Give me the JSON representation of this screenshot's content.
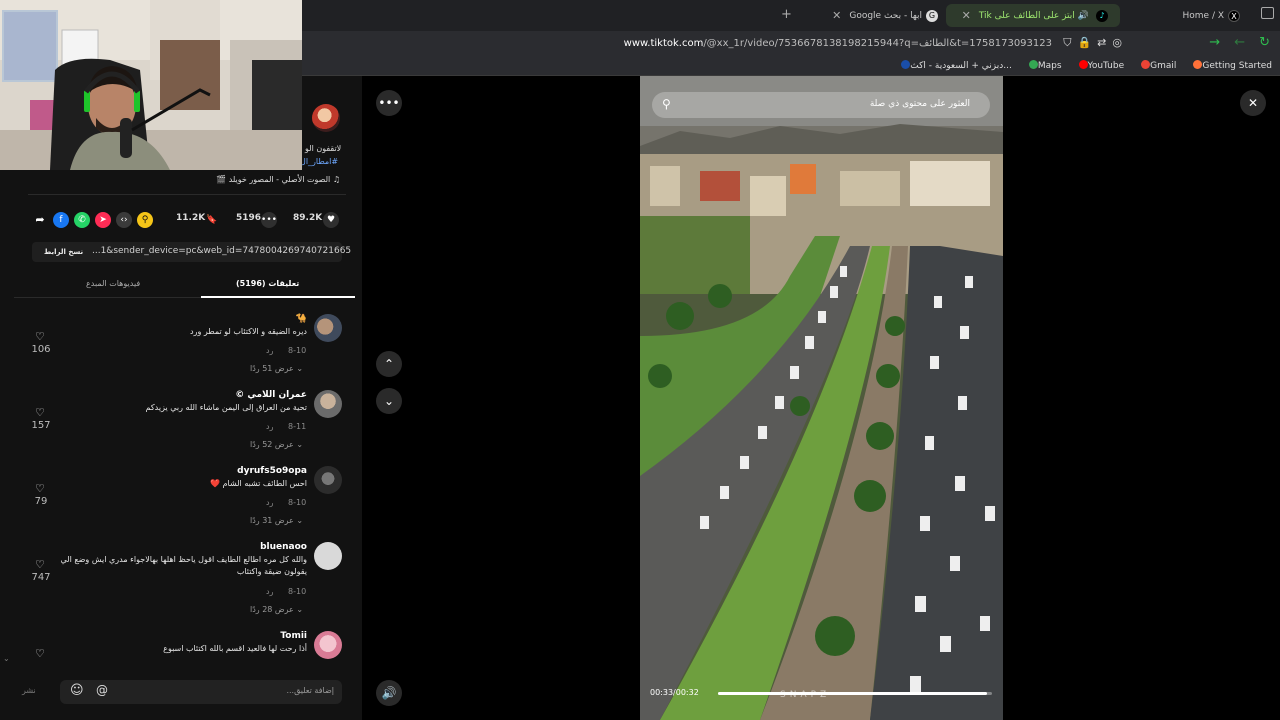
{
  "browser": {
    "tabs": [
      {
        "title": "Home / X",
        "icon": "x-logo-icon"
      },
      {
        "title": "ابتز على الطائف على Tik",
        "icon": "tiktok-icon",
        "active": true
      },
      {
        "title": "ابها - بحث Google",
        "icon": "google-icon"
      }
    ],
    "new_tab": "+",
    "url_host": "www.tiktok.com",
    "url_path": "/@xx_1r/video/7536678138198215944?q=الطائف&t=1758173093123",
    "bookmarks": [
      "Getting Started",
      "Gmail",
      "YouTube",
      "Maps",
      "دبزني + السعودية - اكث..."
    ]
  },
  "post": {
    "caption_line1": "لاتقفون الو",
    "caption_line2": "#امطار_ال",
    "sound": "الصوت الأصلي - المصور خويلد 🎬",
    "likes": "89.2K",
    "comments": "5196",
    "saves": "11.2K",
    "link": "...1&sender_device=pc&web_id=7478004269740721665",
    "copy_link": "نسخ الرابط"
  },
  "tabs": {
    "comments": "تعليقات (5196)",
    "creator_videos": "فيديوهات المبدع"
  },
  "comments": [
    {
      "user": "🐪",
      "text": "ديره الضيقه و الاكتئاب لو تمطر ورد",
      "date": "8-10",
      "reply": "رد",
      "view_replies": "عرض 51 ردًا",
      "likes": "106"
    },
    {
      "user": "عمران اللامي ©",
      "text": "تحية من العراق إلى اليمن ماشاء الله ربي يزيدكم",
      "date": "8-11",
      "reply": "رد",
      "view_replies": "عرض 52 ردًا",
      "likes": "157"
    },
    {
      "user": "dyrufs5o9opa",
      "text": "احس الطائف تشبه الشام ❤️",
      "date": "8-10",
      "reply": "رد",
      "view_replies": "عرض 31 ردًا",
      "likes": "79"
    },
    {
      "user": "bluenaoo",
      "text": "والله كل مره اطالع الطايف اقول ياحظ اهلها بهالاجواء مدري ايش وضع الي يقولون ضيقة واكتئاب",
      "date": "8-10",
      "reply": "رد",
      "view_replies": "عرض 28 ردًا",
      "likes": "747"
    },
    {
      "user": "Tomii",
      "text": "أذا رحت لها فالعيد اقسم بالله اكتئاب اسبوع",
      "date": "",
      "reply": "",
      "view_replies": "",
      "likes": ""
    }
  ],
  "comment_input": {
    "placeholder": "إضافة تعليق...",
    "post": "نشر"
  },
  "video": {
    "search_placeholder": "العثور على محتوى ذي صلة",
    "time": "00:33/00:32",
    "progress": 0.98,
    "watermark": "SNAPZ"
  }
}
